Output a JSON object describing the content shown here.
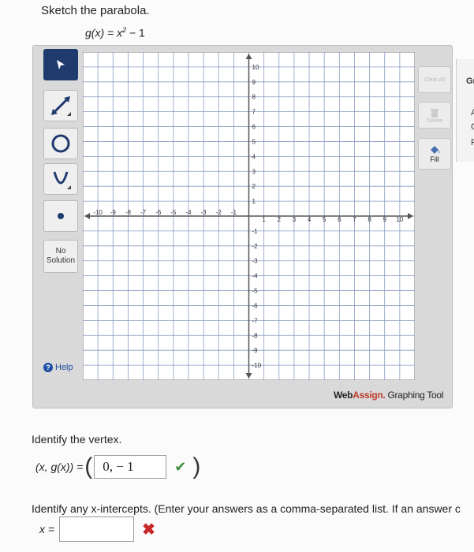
{
  "problem": {
    "instruction": "Sketch the parabola.",
    "func_lhs": "g(x) = x",
    "func_exp": "2",
    "func_rhs": "− 1"
  },
  "toolbar": {
    "no_solution_line1": "No",
    "no_solution_line2": "Solution",
    "help": "Help"
  },
  "graph": {
    "x_ticks": [
      "-10",
      "-9",
      "-8",
      "-7",
      "-6",
      "-5",
      "-4",
      "-3",
      "-2",
      "-1",
      "1",
      "2",
      "3",
      "4",
      "5",
      "6",
      "7",
      "8",
      "9",
      "10"
    ],
    "y_ticks": [
      "10",
      "9",
      "8",
      "7",
      "6",
      "5",
      "4",
      "3",
      "2",
      "1",
      "-1",
      "-2",
      "-3",
      "-4",
      "-5",
      "-6",
      "-7",
      "-8",
      "-9",
      "-10"
    ],
    "fill_label": "Fill",
    "clear_label": "Clear All",
    "delete_label": "Delete"
  },
  "branding": {
    "web": "Web",
    "assign": "Assign.",
    "rest": " Graphing Tool"
  },
  "right_panel": {
    "a": "Gr",
    "b": "A",
    "c": "C",
    "d": "P"
  },
  "q1": {
    "prompt": "Identify the vertex.",
    "label": "(x, g(x)) =",
    "value": "0, − 1"
  },
  "q2": {
    "prompt": "Identify any x-intercepts. (Enter your answers as a comma-separated list. If an answer c",
    "label": "x ="
  },
  "colors": {
    "axis": "#555555",
    "grid": "#8a9cc4",
    "active_tool": "#1f3b6e",
    "correct": "#3f8f3f",
    "wrong": "#c62828"
  }
}
